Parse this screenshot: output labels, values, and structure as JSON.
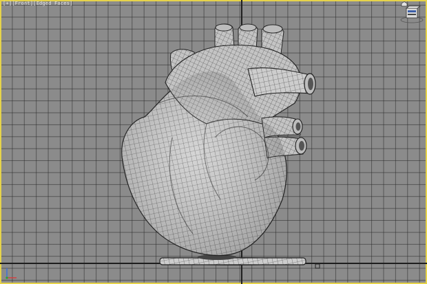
{
  "viewport": {
    "label_parts": [
      "[+]",
      "[Front]",
      "[Edged Faces]"
    ]
  },
  "icons": {
    "world_axis": "axis-gizmo-icon",
    "viewcube": "viewcube-icon",
    "home": "home-icon"
  },
  "colors": {
    "grid_background": "#8b8b8b",
    "grid_line": "#282828",
    "active_border": "#e6d34a",
    "label_text": "#e8e8e8",
    "wireframe": "#2a2a2a",
    "surface": "#c9c9c9"
  },
  "model": {
    "object": "heart mesh"
  }
}
